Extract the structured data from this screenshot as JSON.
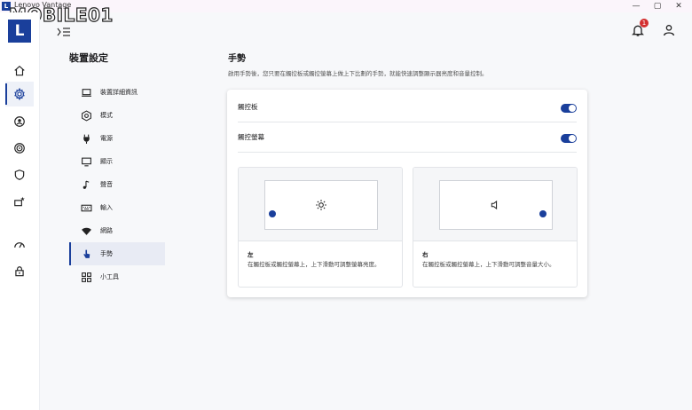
{
  "window": {
    "title": "Lenovo Vantage",
    "app_icon_letter": "L",
    "minimize": "—",
    "maximize": "▢",
    "close": "✕"
  },
  "watermark": "MOBILE01",
  "logo_letter": "L",
  "notification_count": "1",
  "settings": {
    "title": "裝置設定",
    "nav": [
      {
        "label": "裝置詳細資訊",
        "icon": "laptop-icon"
      },
      {
        "label": "模式",
        "icon": "hexagon-gear-icon"
      },
      {
        "label": "電源",
        "icon": "plug-icon"
      },
      {
        "label": "顯示",
        "icon": "monitor-icon"
      },
      {
        "label": "聲音",
        "icon": "music-note-icon"
      },
      {
        "label": "輸入",
        "icon": "keyboard-icon"
      },
      {
        "label": "網路",
        "icon": "wifi-icon"
      },
      {
        "label": "手勢",
        "icon": "hand-touch-icon",
        "active": true
      },
      {
        "label": "小工具",
        "icon": "widgets-icon"
      }
    ]
  },
  "main": {
    "title": "手勢",
    "description": "啟用手勢後，您只要在觸控板或觸控螢幕上做上下比劃的手勢，就能快速調整顯示器亮度和音量控制。",
    "toggles": [
      {
        "label": "觸控板",
        "on": true
      },
      {
        "label": "觸控螢幕",
        "on": true
      }
    ],
    "demos": [
      {
        "title": "左",
        "description": "在觸控板或觸控螢幕上，上下滑動可調整螢幕亮度。",
        "icon": "brightness-icon"
      },
      {
        "title": "右",
        "description": "在觸控板或觸控螢幕上，上下滑動可調整音量大小。",
        "icon": "volume-icon"
      }
    ]
  },
  "colors": {
    "accent": "#1a3f9b",
    "badge": "#d32f2f"
  }
}
